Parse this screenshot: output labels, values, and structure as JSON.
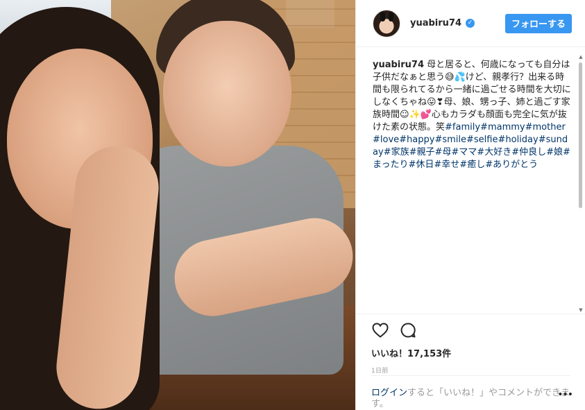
{
  "post": {
    "username": "yuabiru74",
    "verified_icon": "check-icon",
    "follow_label": "フォローする",
    "caption_user": "yuabiru74",
    "caption_parts": [
      {
        "kind": "text",
        "value": " 母と居ると、何歳になっても自分は子供だなぁと思う😅💦けど、親孝行？出来る時間も限られてるから一緒に過ごせる時間を大切にしなくちゃね😛❣母、娘、甥っ子、姉と過ごす家族時間☺✨💕心もカラダも顔面も完全に気が抜けた素の状態。笑"
      },
      {
        "kind": "tag",
        "value": "#family"
      },
      {
        "kind": "tag",
        "value": "#mammy"
      },
      {
        "kind": "tag",
        "value": "#mother"
      },
      {
        "kind": "tag",
        "value": "#love"
      },
      {
        "kind": "tag",
        "value": "#happy"
      },
      {
        "kind": "tag",
        "value": "#smile"
      },
      {
        "kind": "tag",
        "value": "#selfie"
      },
      {
        "kind": "tag",
        "value": "#holiday"
      },
      {
        "kind": "tag",
        "value": "#sunday"
      },
      {
        "kind": "tag",
        "value": "#家族"
      },
      {
        "kind": "tag",
        "value": "#親子"
      },
      {
        "kind": "tag",
        "value": "#母"
      },
      {
        "kind": "tag",
        "value": "#ママ"
      },
      {
        "kind": "tag",
        "value": "#大好き"
      },
      {
        "kind": "tag",
        "value": "#仲良し"
      },
      {
        "kind": "tag",
        "value": "#娘"
      },
      {
        "kind": "tag",
        "value": "#まったり"
      },
      {
        "kind": "tag",
        "value": "#休日"
      },
      {
        "kind": "tag",
        "value": "#幸せ"
      },
      {
        "kind": "tag",
        "value": "#癒し"
      },
      {
        "kind": "tag",
        "value": "#ありがとう"
      }
    ],
    "likes_label": "いいね！17,153件",
    "time_ago": "1日前",
    "comment_login": "ログイン",
    "comment_suffix": "すると「いいね！」やコメントができます。",
    "more_label": "•••"
  },
  "colors": {
    "accent": "#3897f0",
    "hashtag": "#003569",
    "muted": "#999999"
  }
}
